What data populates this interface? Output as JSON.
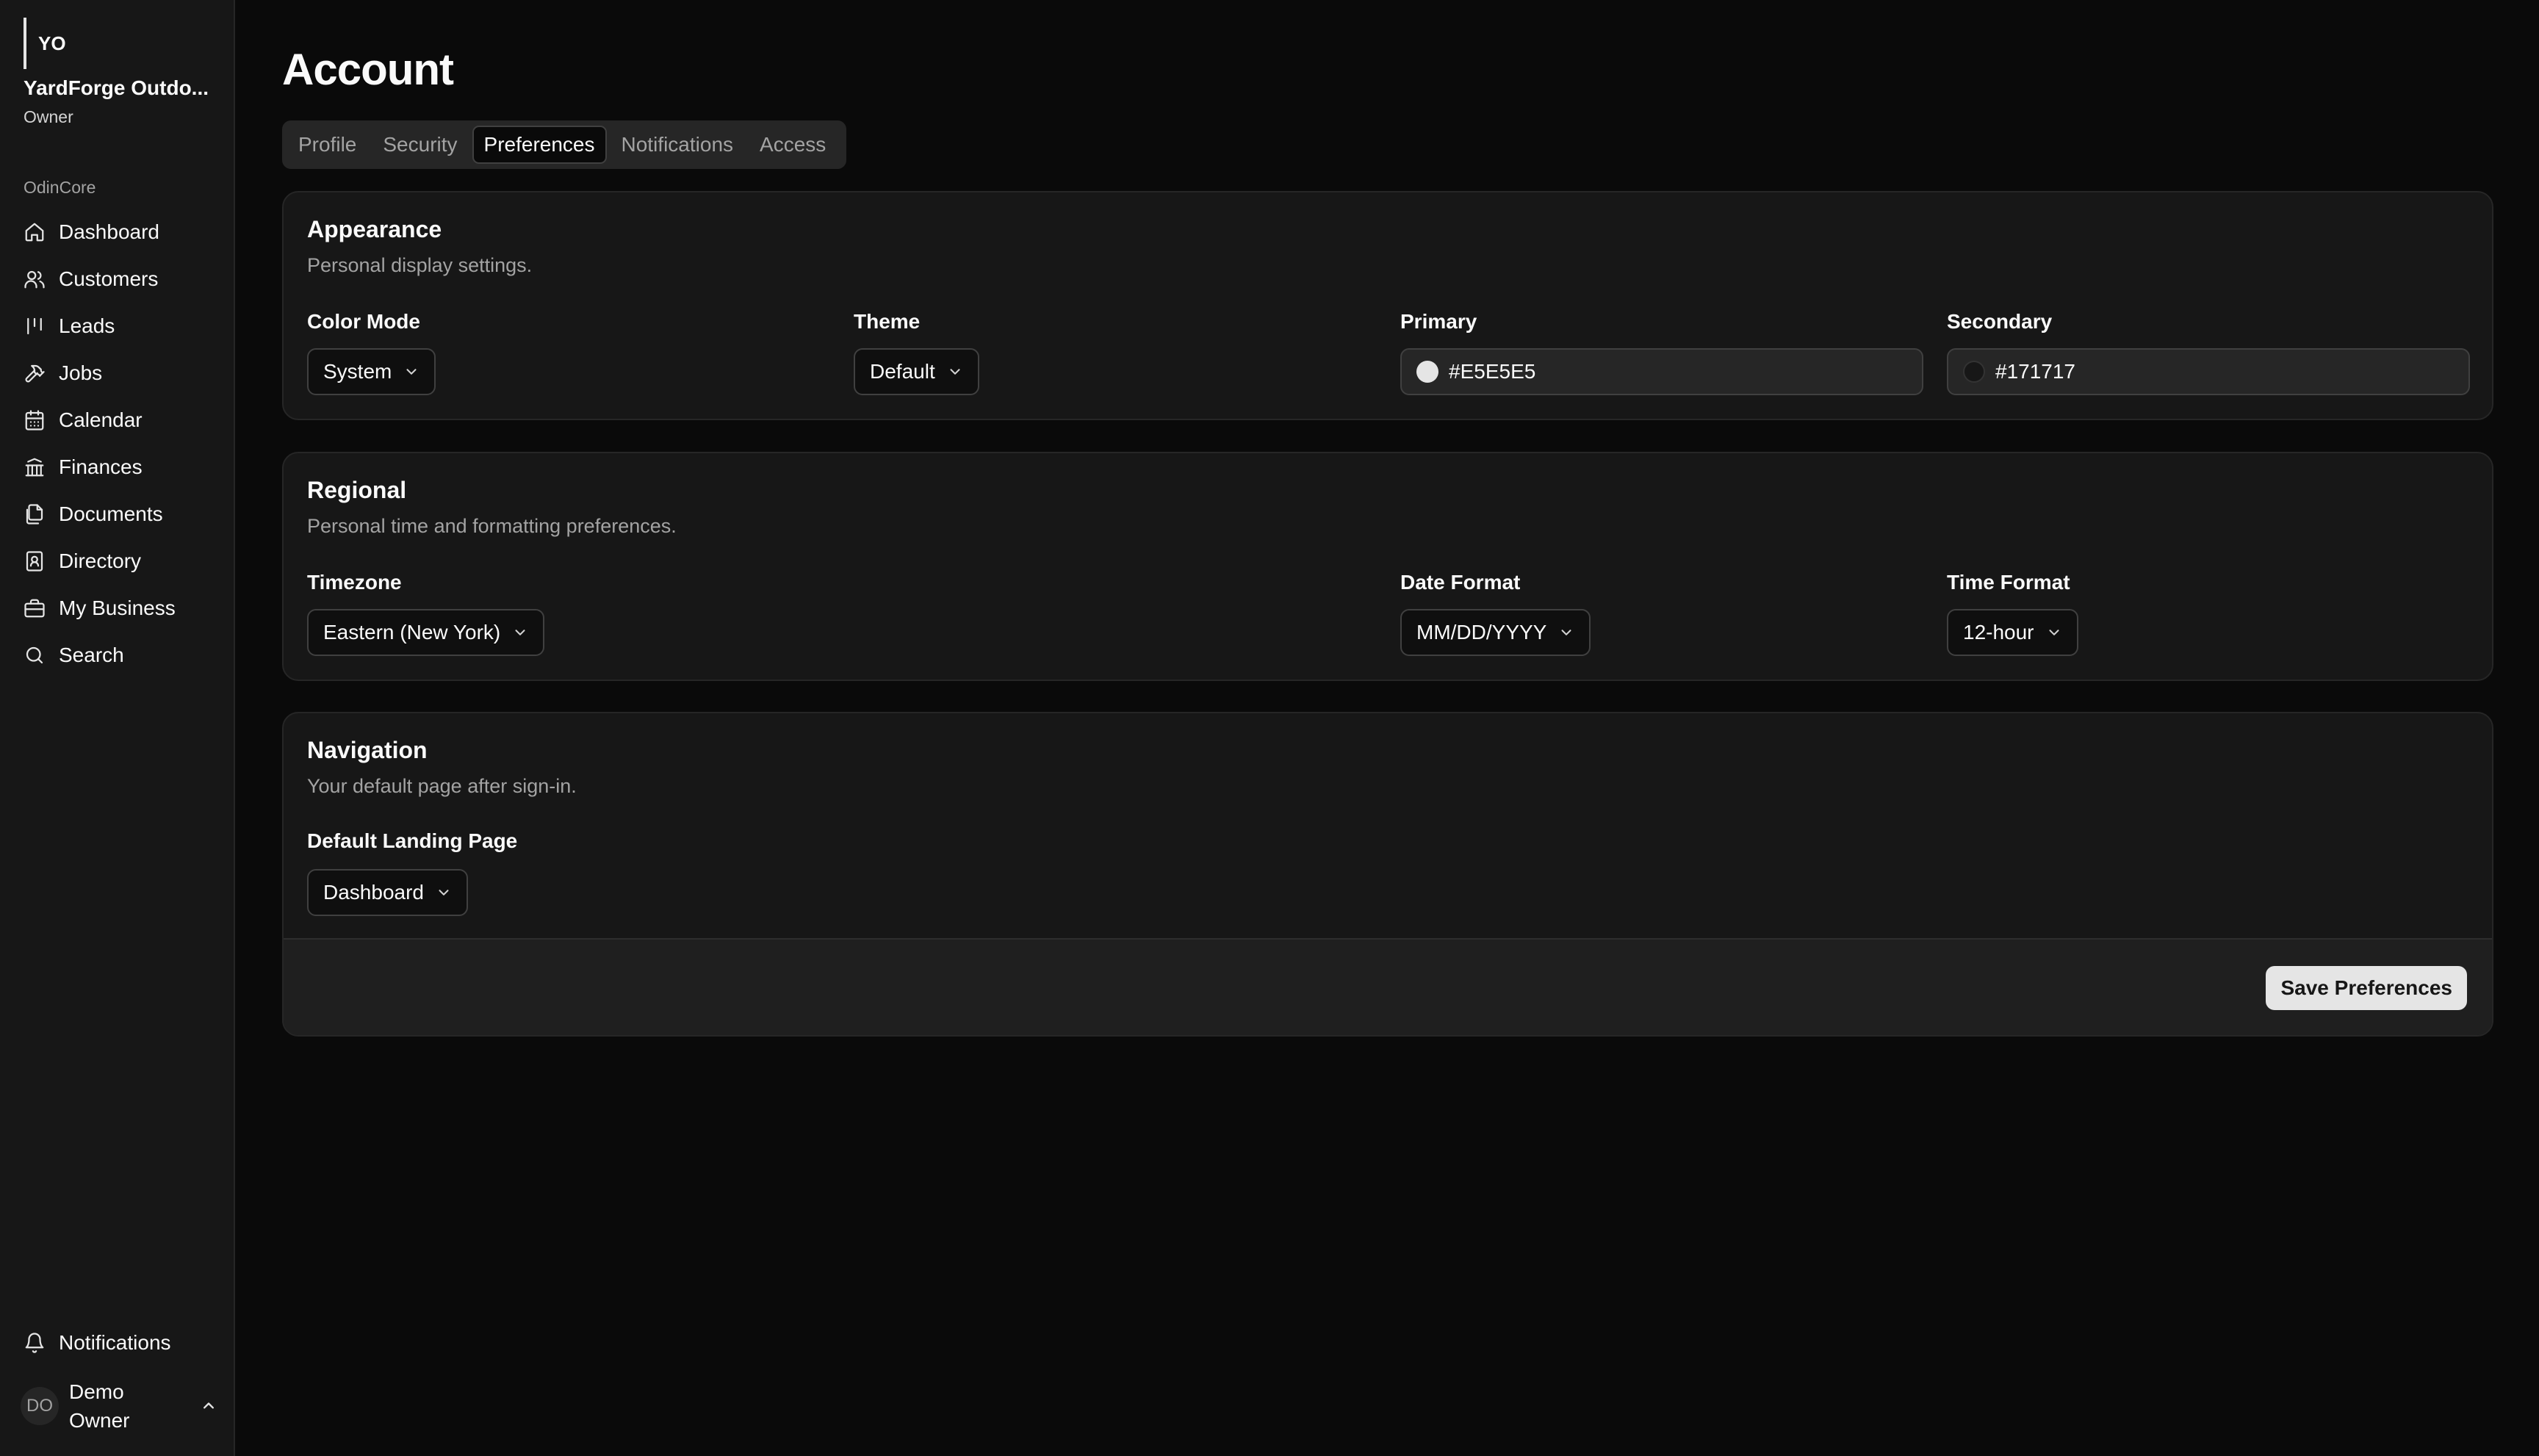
{
  "sidebar": {
    "org_initials": "YO",
    "org_name": "YardForge Outdo...",
    "org_role": "Owner",
    "group_label": "OdinCore",
    "items": [
      {
        "label": "Dashboard",
        "icon": "home-icon"
      },
      {
        "label": "Customers",
        "icon": "users-icon"
      },
      {
        "label": "Leads",
        "icon": "kanban-icon"
      },
      {
        "label": "Jobs",
        "icon": "hammer-icon"
      },
      {
        "label": "Calendar",
        "icon": "calendar-icon"
      },
      {
        "label": "Finances",
        "icon": "bank-icon"
      },
      {
        "label": "Documents",
        "icon": "documents-icon"
      },
      {
        "label": "Directory",
        "icon": "contact-book-icon"
      },
      {
        "label": "My Business",
        "icon": "briefcase-icon"
      },
      {
        "label": "Search",
        "icon": "search-icon"
      }
    ],
    "notifications_label": "Notifications",
    "user": {
      "initials": "DO",
      "name": "Demo Owner"
    }
  },
  "page": {
    "title": "Account",
    "tabs": [
      {
        "label": "Profile",
        "active": false
      },
      {
        "label": "Security",
        "active": false
      },
      {
        "label": "Preferences",
        "active": true
      },
      {
        "label": "Notifications",
        "active": false
      },
      {
        "label": "Access",
        "active": false
      }
    ]
  },
  "appearance": {
    "title": "Appearance",
    "description": "Personal display settings.",
    "color_mode": {
      "label": "Color Mode",
      "value": "System"
    },
    "theme": {
      "label": "Theme",
      "value": "Default"
    },
    "primary": {
      "label": "Primary",
      "value": "#E5E5E5",
      "swatch": "#E5E5E5"
    },
    "secondary": {
      "label": "Secondary",
      "value": "#171717",
      "swatch": "#171717"
    }
  },
  "regional": {
    "title": "Regional",
    "description": "Personal time and formatting preferences.",
    "timezone": {
      "label": "Timezone",
      "value": "Eastern (New York)"
    },
    "date_format": {
      "label": "Date Format",
      "value": "MM/DD/YYYY"
    },
    "time_format": {
      "label": "Time Format",
      "value": "12-hour"
    }
  },
  "navigation": {
    "title": "Navigation",
    "description": "Your default page after sign-in.",
    "landing": {
      "label": "Default Landing Page",
      "value": "Dashboard"
    },
    "save_label": "Save Preferences"
  }
}
